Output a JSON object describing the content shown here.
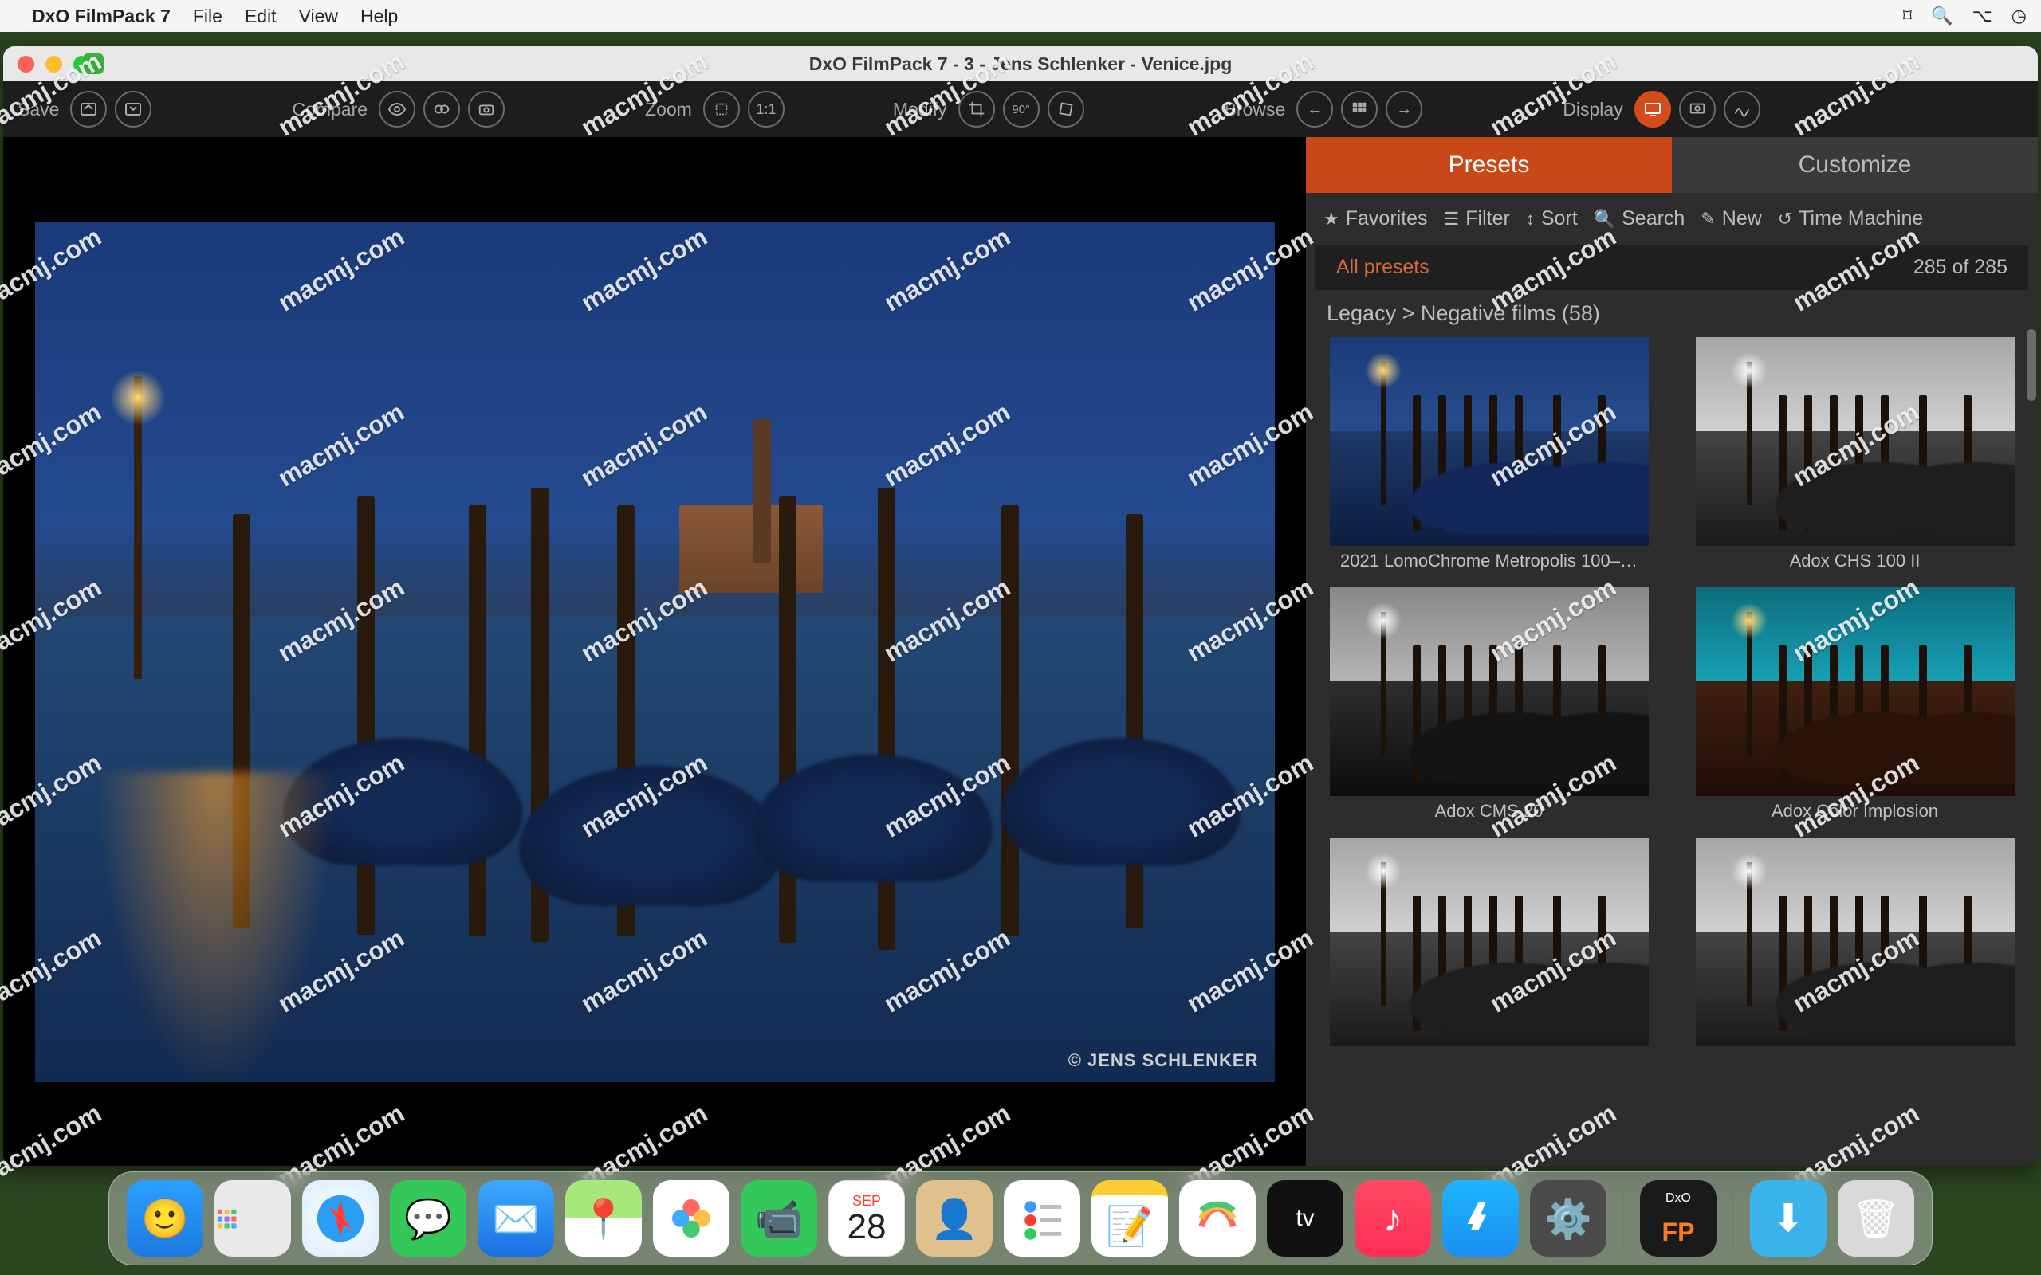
{
  "menubar": {
    "app": "DxO FilmPack 7",
    "items": [
      "File",
      "Edit",
      "View",
      "Help"
    ]
  },
  "window": {
    "title": "DxO FilmPack 7 - 3 - Jens Schlenker - Venice.jpg"
  },
  "toolbar": {
    "save": "Save",
    "compare": "Compare",
    "zoom": "Zoom",
    "one_to_one": "1:1",
    "modify": "Modify",
    "browse": "Browse",
    "display": "Display"
  },
  "photo": {
    "copyright": "© JENS SCHLENKER"
  },
  "panel": {
    "tabs": {
      "presets": "Presets",
      "customize": "Customize"
    },
    "filters": {
      "favorites": "Favorites",
      "filter": "Filter",
      "sort": "Sort",
      "search": "Search",
      "new": "New",
      "time_machine": "Time Machine"
    },
    "breadcrumb": {
      "label": "All presets",
      "count": "285 of 285"
    },
    "section": "Legacy > Negative films (58)",
    "presets": [
      {
        "label": "2021 LomoChrome Metropolis 100–…",
        "tone": "blue"
      },
      {
        "label": "Adox CHS 100 II",
        "tone": "bw"
      },
      {
        "label": "Adox CMS 20",
        "tone": "bw2"
      },
      {
        "label": "Adox Color Implosion",
        "tone": "teal"
      },
      {
        "label": "",
        "tone": "bw"
      },
      {
        "label": "",
        "tone": "bw"
      }
    ]
  },
  "dock": {
    "calendar": {
      "month": "SEP",
      "day": "28"
    },
    "filmpack": {
      "brand": "DxO",
      "label": "FP"
    },
    "items": [
      "finder",
      "launchpad",
      "safari",
      "messages",
      "mail",
      "maps",
      "photos",
      "facetime",
      "calendar",
      "contacts",
      "reminders",
      "notes",
      "freeform",
      "tv",
      "music",
      "app-store",
      "settings",
      "separator",
      "filmpack",
      "separator",
      "downloads",
      "trash"
    ]
  },
  "watermark": "macmj.com"
}
